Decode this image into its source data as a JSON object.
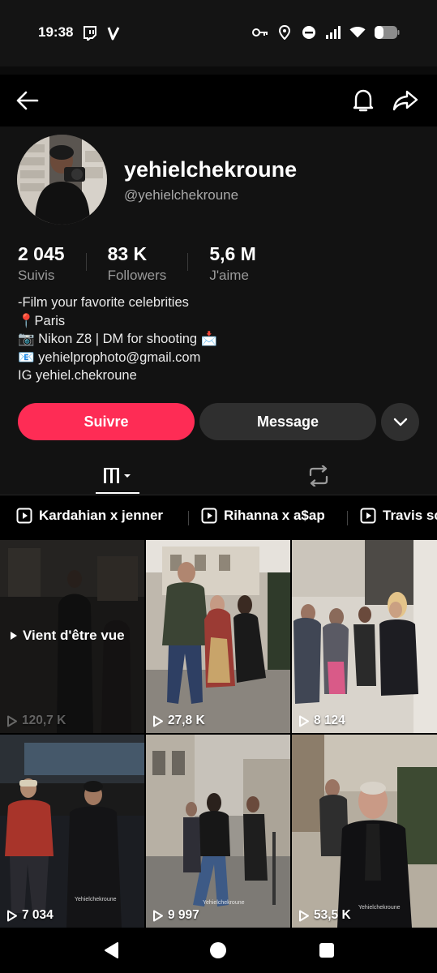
{
  "status_bar": {
    "time": "19:38",
    "left_icons": [
      "twitch-icon",
      "v-app-icon"
    ],
    "right_icons": [
      "key-icon",
      "location-icon",
      "dnd-icon",
      "signal-icon",
      "wifi-icon",
      "battery-icon"
    ]
  },
  "top_bar": {
    "back_icon": "arrow-left-icon",
    "bell_icon": "bell-icon",
    "share_icon": "share-arrow-icon"
  },
  "profile": {
    "display_name": "yehielchekroune",
    "handle": "@yehielchekroune",
    "stats": [
      {
        "value": "2 045",
        "label": "Suivis"
      },
      {
        "value": "83 K",
        "label": "Followers"
      },
      {
        "value": "5,6 M",
        "label": "J'aime"
      }
    ],
    "bio": {
      "line1": "-Film your favorite celebrities",
      "line2_icon": "📍",
      "line2": "Paris",
      "line3_icon": "📷",
      "line3": "Nikon Z8 | DM for shooting",
      "line3_end_icon": "📩",
      "line4_icon": "📧",
      "line4": "yehielprophoto@gmail.com",
      "line5": "IG  yehiel.chekroune"
    },
    "buttons": {
      "follow": "Suivre",
      "message": "Message"
    }
  },
  "tabs": [
    {
      "icon": "grid-icon",
      "selected": true
    },
    {
      "icon": "repost-icon",
      "selected": false
    }
  ],
  "playlists": [
    {
      "label": "Kardahian x jenner"
    },
    {
      "label": "Rihanna x a$ap"
    },
    {
      "label": "Travis sc"
    }
  ],
  "videos": [
    {
      "views": "120,7 K",
      "badge": "Vient d'être vue",
      "watched": true
    },
    {
      "views": "27,8 K",
      "watched": false
    },
    {
      "views": "8 124",
      "watched": false
    },
    {
      "views": "7 034",
      "watched": false,
      "watermark": "Yehielchekroune"
    },
    {
      "views": "9 997",
      "watched": false,
      "watermark": "Yehielchekroune"
    },
    {
      "views": "53,5 K",
      "watched": false,
      "watermark": "Yehielchekroune"
    }
  ],
  "colors": {
    "accent": "#fe2c55",
    "background": "#000000",
    "panel": "#121212",
    "secondary_button": "#2f2f2f"
  }
}
